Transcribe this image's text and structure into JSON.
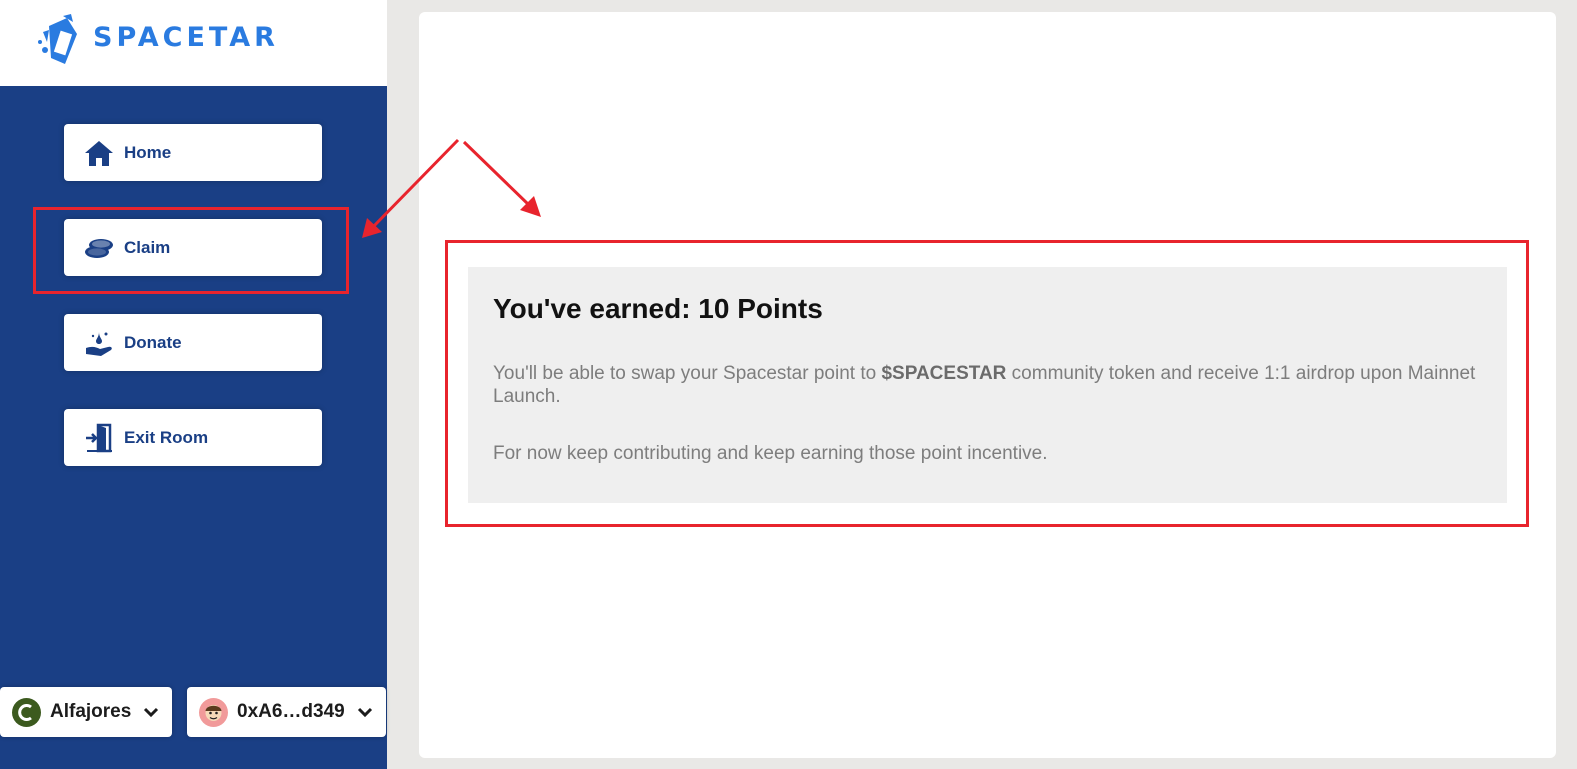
{
  "brand": {
    "name": "SPACETAR",
    "color": "#2a7be0"
  },
  "colors": {
    "sidebar": "#1a3f85",
    "highlight": "#e8242d",
    "card_bg": "#efefef"
  },
  "nav": {
    "items": [
      {
        "label": "Home",
        "icon": "home-icon"
      },
      {
        "label": "Claim",
        "icon": "coins-icon"
      },
      {
        "label": "Donate",
        "icon": "donate-hand-icon"
      },
      {
        "label": "Exit Room",
        "icon": "exit-door-icon"
      }
    ]
  },
  "network": {
    "label": "Alfajores",
    "icon": "celo-network-icon"
  },
  "account": {
    "label": "0xA6…d349",
    "icon": "account-avatar-icon"
  },
  "card": {
    "title": "You've earned: 10 Points",
    "desc_before": "You'll be able to swap your Spacestar point to ",
    "desc_token": "$SPACESTAR",
    "desc_after": " community token and receive 1:1 airdrop upon Mainnet Launch.",
    "note": "For now keep contributing and keep earning those point incentive."
  }
}
